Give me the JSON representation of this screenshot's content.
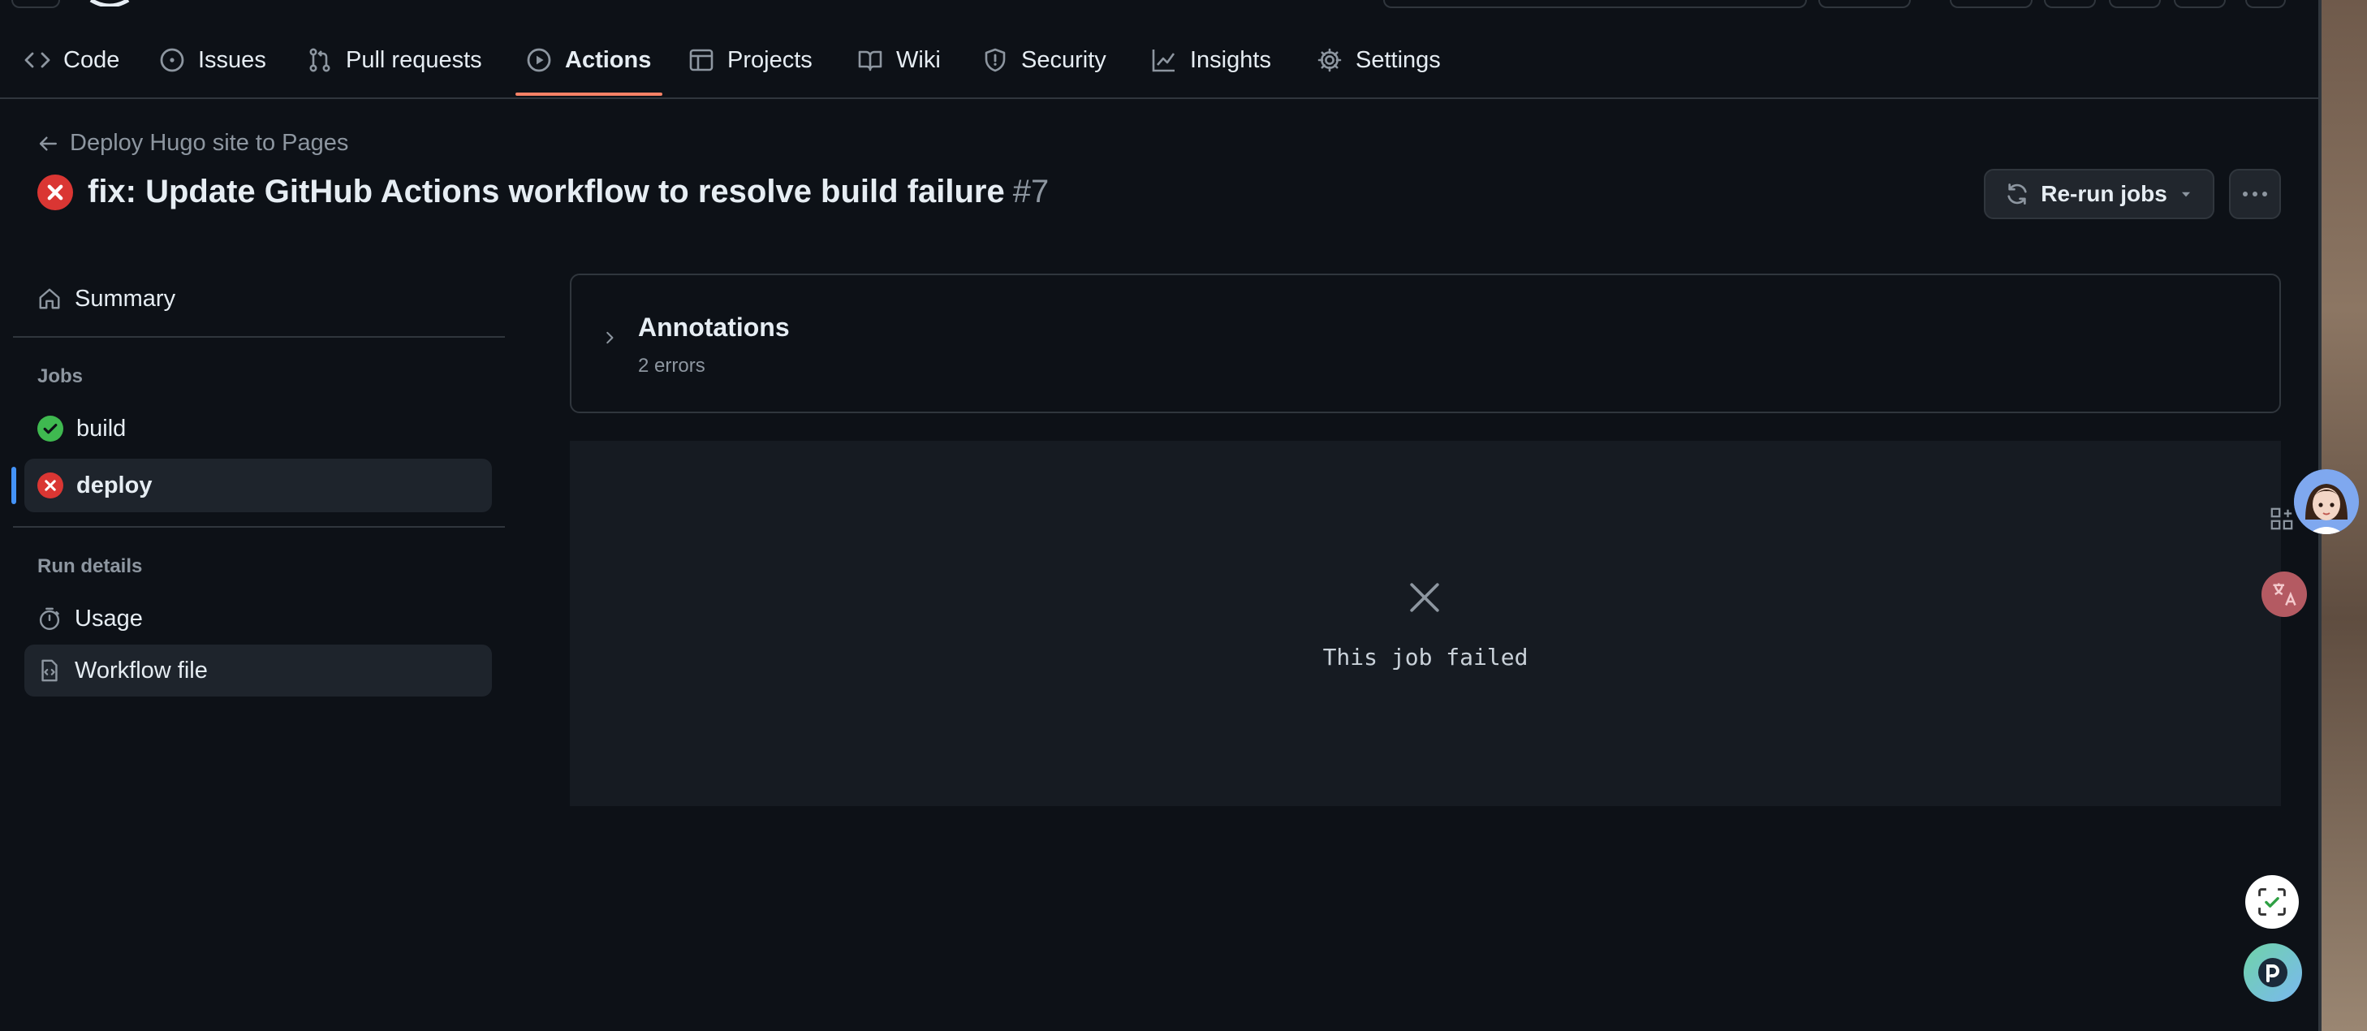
{
  "nav": {
    "items": [
      {
        "label": "Code",
        "icon": "code-icon"
      },
      {
        "label": "Issues",
        "icon": "issue-opened-icon"
      },
      {
        "label": "Pull requests",
        "icon": "git-pull-request-icon"
      },
      {
        "label": "Actions",
        "icon": "play-icon",
        "active": true
      },
      {
        "label": "Projects",
        "icon": "table-icon"
      },
      {
        "label": "Wiki",
        "icon": "book-icon"
      },
      {
        "label": "Security",
        "icon": "shield-icon"
      },
      {
        "label": "Insights",
        "icon": "graph-icon"
      },
      {
        "label": "Settings",
        "icon": "gear-icon"
      }
    ],
    "active_color": "#f78166"
  },
  "header": {
    "back_label": "Deploy Hugo site to Pages",
    "title": "fix: Update GitHub Actions workflow to resolve build failure",
    "run_number": "#7",
    "status": "failed",
    "rerun_label": "Re-run jobs"
  },
  "sidebar": {
    "summary_label": "Summary",
    "jobs_heading": "Jobs",
    "jobs": [
      {
        "label": "build",
        "status": "success"
      },
      {
        "label": "deploy",
        "status": "failure",
        "selected": true
      }
    ],
    "run_details_heading": "Run details",
    "details": [
      {
        "label": "Usage",
        "icon": "stopwatch-icon"
      },
      {
        "label": "Workflow file",
        "icon": "file-code-icon",
        "selected": true
      }
    ]
  },
  "main": {
    "annotations_title": "Annotations",
    "annotations_sub": "2 errors",
    "failure_message": "This job failed"
  },
  "colors": {
    "background": "#0d1117",
    "border": "#30363d",
    "success": "#3fb950",
    "danger": "#da3633",
    "muted": "#8d96a0"
  }
}
